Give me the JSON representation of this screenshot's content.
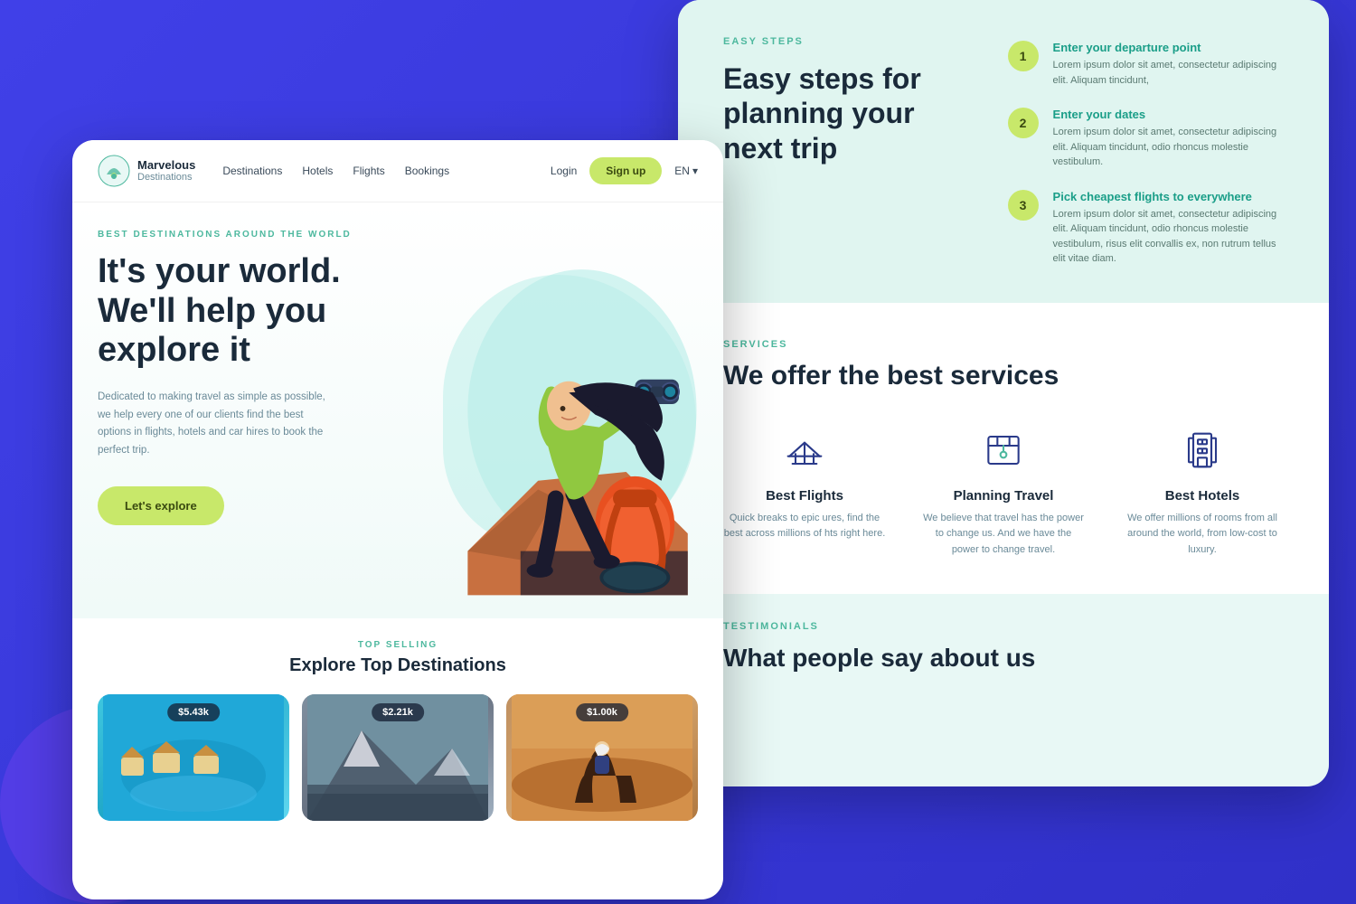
{
  "background": {
    "color": "#3d3de8"
  },
  "back_card": {
    "easy_steps": {
      "label": "EASY STEPS",
      "title": "Easy steps for planning your next trip",
      "steps": [
        {
          "num": "1",
          "heading": "Enter your departure point",
          "desc": "Lorem ipsum dolor sit amet, consectetur adipiscing elit. Aliquam tincidunt,"
        },
        {
          "num": "2",
          "heading": "Enter your dates",
          "desc": "Lorem ipsum dolor sit amet, consectetur adipiscing elit. Aliquam tincidunt, odio rhoncus molestie vestibulum."
        },
        {
          "num": "3",
          "heading": "Pick cheapest flights to everywhere",
          "desc": "Lorem ipsum dolor sit amet, consectetur adipiscing elit. Aliquam tincidunt, odio rhoncus molestie vestibulum, risus elit convallis ex, non rutrum tellus elit vitae diam."
        }
      ]
    },
    "services": {
      "label": "SERVICES",
      "title": "We offer the best services",
      "items": [
        {
          "icon": "✈",
          "title": "Best Flights",
          "desc": "Quick breaks to epic ures, find the best across millions of hts right here."
        },
        {
          "icon": "🗺",
          "title": "Planning Travel",
          "desc": "We believe that travel has the power to change us. And we have the power to change travel."
        },
        {
          "icon": "🏨",
          "title": "Best Hotels",
          "desc": "We offer millions of rooms from all around the world, from low-cost to luxury."
        }
      ]
    },
    "testimonials": {
      "label": "TESTIMONIALS",
      "title": "What people say about us"
    }
  },
  "front_card": {
    "logo": {
      "name": "Marvelous",
      "sub": "Destinations"
    },
    "nav": {
      "links": [
        "Destinations",
        "Hotels",
        "Flights",
        "Bookings",
        "Login"
      ],
      "signup": "Sign up",
      "lang": "EN"
    },
    "hero": {
      "badge": "BEST DESTINATIONS AROUND THE WORLD",
      "title": "It's your world. We'll help you explore it",
      "desc": "Dedicated to making travel as simple as possible, we help every one of our clients find the best options in flights, hotels and car hires to book the perfect trip.",
      "cta": "Let's explore"
    },
    "destinations": {
      "label": "TOP SELLING",
      "title": "Explore Top Destinations",
      "cards": [
        {
          "price": "$5.43k",
          "theme": "ocean"
        },
        {
          "price": "$2.21k",
          "theme": "mountain"
        },
        {
          "price": "$1.00k",
          "theme": "desert"
        }
      ]
    }
  }
}
